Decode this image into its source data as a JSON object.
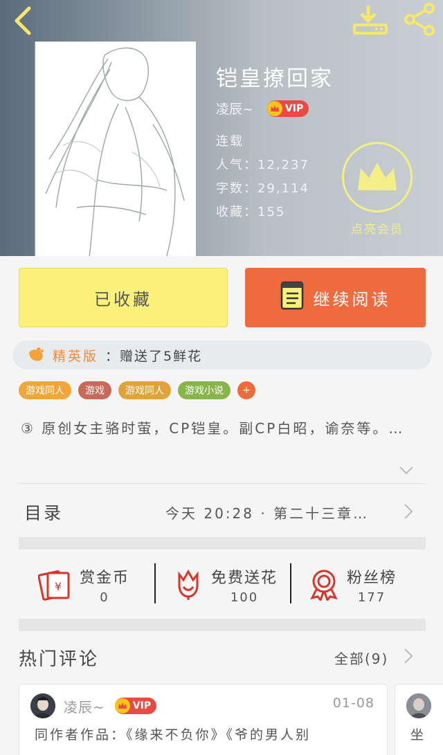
{
  "book": {
    "title": "铠皇撩回家",
    "author": "凌辰~",
    "vip_label": "VIP",
    "status": "连载",
    "popularity": "人气：12,237",
    "word_count": "字数：29,114",
    "favorites": "收藏：155",
    "member_label": "点亮会员"
  },
  "actions": {
    "collect_label": "已收藏",
    "read_label": "继续阅读"
  },
  "flower": {
    "edition": "精英版",
    "message": "：赠送了5鲜花"
  },
  "tags": [
    {
      "label": "游戏同人",
      "color": "#f0a63a"
    },
    {
      "label": "游戏",
      "color": "#c9695a"
    },
    {
      "label": "游戏同人",
      "color": "#e0a33a"
    },
    {
      "label": "游戏小说",
      "color": "#88b54a"
    }
  ],
  "tag_more": "+",
  "description": "③ 原创女主骆时萤，CP铠皇。副CP白昭，谕奈等。…",
  "toc": {
    "label": "目录",
    "latest": "今天 20:28 · 第二十三章…"
  },
  "stats": [
    {
      "label": "赏金币",
      "value": "0",
      "icon": "red-envelope-icon"
    },
    {
      "label": "免费送花",
      "value": "100",
      "icon": "flower-icon"
    },
    {
      "label": "粉丝榜",
      "value": "177",
      "icon": "medal-icon"
    }
  ],
  "reviews": {
    "title": "热门评论",
    "all_label": "全部(9)",
    "cards": [
      {
        "user": "凌辰~",
        "vip": "VIP",
        "date": "01-08",
        "text": "同作者作品：《缘来不负你》《爷的男人别"
      },
      {
        "text": "坐"
      }
    ]
  },
  "colors": {
    "accent_orange": "#ef6a3f",
    "collect_yellow": "#fbf07a",
    "member_yellow": "#f3ee86"
  }
}
